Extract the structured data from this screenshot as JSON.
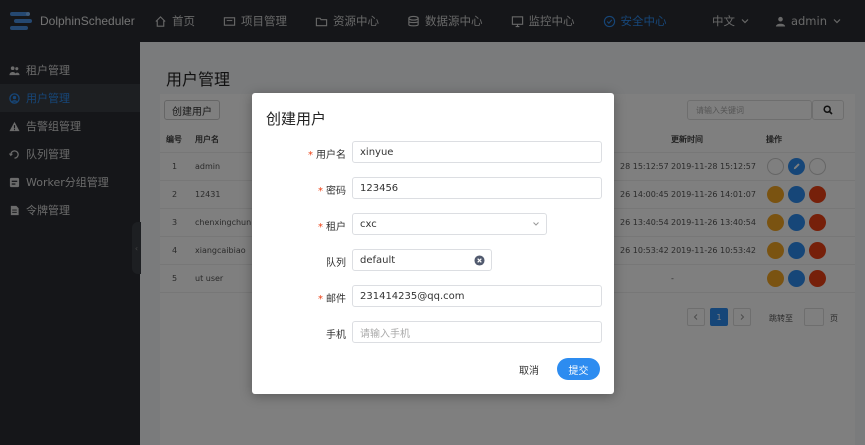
{
  "app": {
    "name": "DolphinScheduler"
  },
  "nav": {
    "items": [
      {
        "label": "首页",
        "icon": "home-icon"
      },
      {
        "label": "项目管理",
        "icon": "project-icon"
      },
      {
        "label": "资源中心",
        "icon": "folder-icon"
      },
      {
        "label": "数据源中心",
        "icon": "database-icon"
      },
      {
        "label": "监控中心",
        "icon": "monitor-icon"
      },
      {
        "label": "安全中心",
        "icon": "shield-icon"
      }
    ],
    "active": "安全中心",
    "language": "中文",
    "user": "admin"
  },
  "sidebar": {
    "items": [
      {
        "label": "租户管理",
        "icon": "tenant-icon"
      },
      {
        "label": "用户管理",
        "icon": "user-icon"
      },
      {
        "label": "告警组管理",
        "icon": "warning-icon"
      },
      {
        "label": "队列管理",
        "icon": "queue-icon"
      },
      {
        "label": "Worker分组管理",
        "icon": "worker-icon"
      },
      {
        "label": "令牌管理",
        "icon": "token-icon"
      }
    ],
    "active": "用户管理"
  },
  "page": {
    "title": "用户管理",
    "create_label": "创建用户",
    "search_placeholder": "请输入关键词",
    "columns": [
      "编号",
      "用户名",
      "更新时间",
      "操作"
    ],
    "rows": [
      {
        "id": "1",
        "username": "admin",
        "create_time_partial": "28 15:12:57",
        "update_time": "2019-11-28 15:12:57"
      },
      {
        "id": "2",
        "username": "12431",
        "create_time_partial": "26 14:00:45",
        "update_time": "2019-11-26 14:01:07"
      },
      {
        "id": "3",
        "username": "chenxingchun",
        "create_time_partial": "26 13:40:54",
        "update_time": "2019-11-26 13:40:54"
      },
      {
        "id": "4",
        "username": "xiangcaibiao",
        "create_time_partial": "26 10:53:42",
        "update_time": "2019-11-26 10:53:42"
      },
      {
        "id": "5",
        "username": "ut user",
        "create_time_partial": "",
        "update_time": "-"
      }
    ],
    "pager": {
      "current": "1",
      "jump_label": "跳转至",
      "page_unit": "页"
    }
  },
  "modal": {
    "title": "创建用户",
    "fields": {
      "username": {
        "label": "用户名",
        "value": "xinyue"
      },
      "password": {
        "label": "密码",
        "value": "123456"
      },
      "tenant": {
        "label": "租户",
        "value": "cxc"
      },
      "queue": {
        "label": "队列",
        "value": "default"
      },
      "email": {
        "label": "邮件",
        "value": "231414235@qq.com"
      },
      "phone": {
        "label": "手机",
        "placeholder": "请输入手机"
      }
    },
    "cancel_label": "取消",
    "submit_label": "提交"
  },
  "colors": {
    "primary": "#2d8cf0",
    "nav_bg": "#2a2d33",
    "danger": "#ed4014",
    "warning": "#f5a623"
  }
}
